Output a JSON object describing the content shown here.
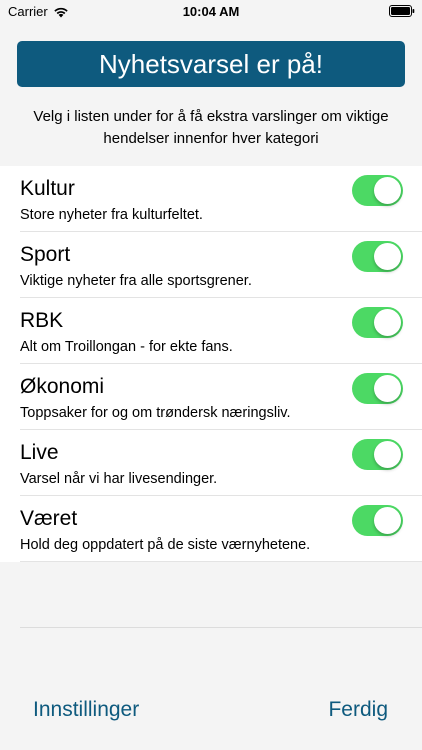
{
  "status_bar": {
    "carrier": "Carrier",
    "time": "10:04 AM",
    "icons": [
      "wifi-icon",
      "battery-icon"
    ]
  },
  "banner": {
    "text": "Nyhetsvarsel er på!",
    "color": "#0e5a7e"
  },
  "intro": {
    "text": "Velg i listen under for å få ekstra varslinger om viktige hendelser innenfor hver kategori"
  },
  "categories": [
    {
      "title": "Kultur",
      "subtitle": "Store nyheter fra kulturfeltet.",
      "enabled": true
    },
    {
      "title": "Sport",
      "subtitle": "Viktige nyheter fra alle sportsgrener.",
      "enabled": true
    },
    {
      "title": "RBK",
      "subtitle": "Alt om Troillongan - for ekte fans.",
      "enabled": true
    },
    {
      "title": "Økonomi",
      "subtitle": "Toppsaker for og om trøndersk næringsliv.",
      "enabled": true
    },
    {
      "title": "Live",
      "subtitle": "Varsel når vi har livesendinger.",
      "enabled": true
    },
    {
      "title": "Været",
      "subtitle": "Hold deg oppdatert på de siste værnyhetene.",
      "enabled": true
    }
  ],
  "toggle_on_color": "#4cd964",
  "footer": {
    "settings_label": "Innstillinger",
    "done_label": "Ferdig"
  }
}
